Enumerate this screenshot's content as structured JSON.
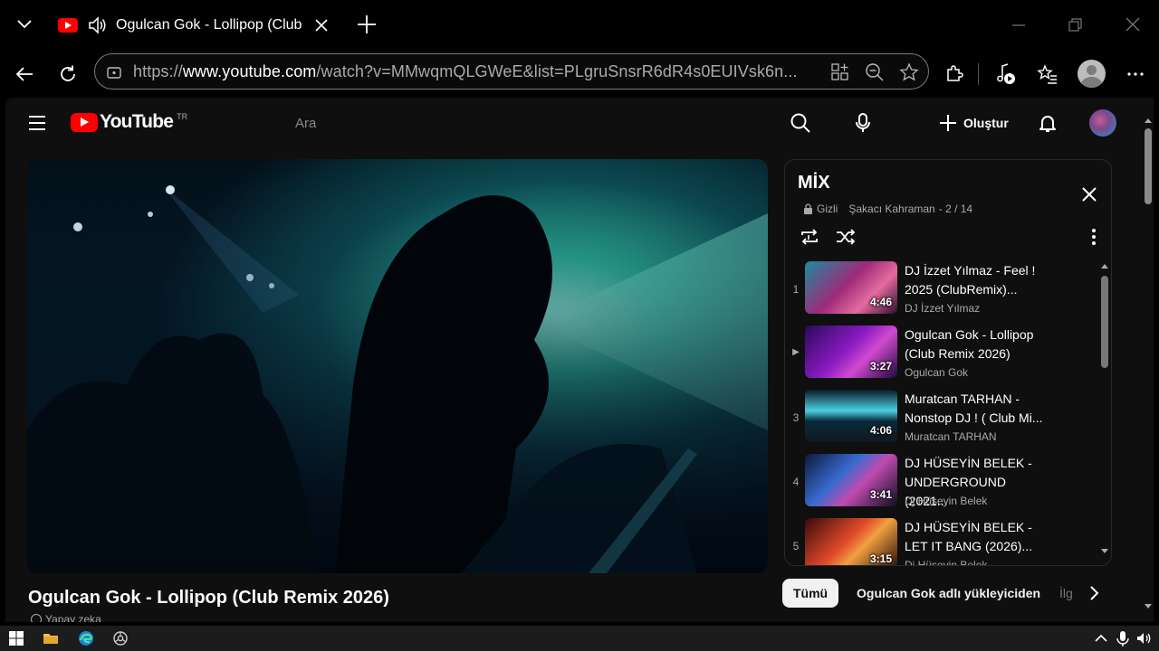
{
  "browser": {
    "tab_title": "Ogulcan Gok - Lollipop (Club",
    "url_prefix": "https://",
    "url_host": "www.youtube.com",
    "url_path": "/watch?v=MMwqmQLGWeE&list=PLgruSnsrR6dR4s0EUIVsk6n..."
  },
  "youtube": {
    "logo_text": "YouTube",
    "country_code": "TR",
    "search_placeholder": "Ara",
    "create_label": "Oluştur"
  },
  "video": {
    "title": "Ogulcan Gok - Lollipop (Club Remix 2026)",
    "ai_note": "Yapay zeka"
  },
  "playlist": {
    "title": "MİX",
    "privacy": "Gizli",
    "owner": "Şakacı Kahraman",
    "position": "- 2 / 14",
    "items": [
      {
        "index": "1",
        "title": "DJ İzzet Yılmaz - Feel ! 2025 (ClubRemix)...",
        "channel": "DJ İzzet Yılmaz",
        "duration": "4:46"
      },
      {
        "index": "▶",
        "title": "Ogulcan Gok - Lollipop (Club Remix 2026)",
        "channel": "Ogulcan Gok",
        "duration": "3:27"
      },
      {
        "index": "3",
        "title": "Muratcan TARHAN - Nonstop DJ ! ( Club Mi...",
        "channel": "Muratcan TARHAN",
        "duration": "4:06"
      },
      {
        "index": "4",
        "title": "DJ HÜSEYİN BELEK - UNDERGROUND (2021...",
        "channel": "Dj Hüseyin Belek",
        "duration": "3:41"
      },
      {
        "index": "5",
        "title": "DJ HÜSEYİN BELEK - LET IT BANG (2026)...",
        "channel": "Dj Hüseyin Belek",
        "duration": "3:15"
      }
    ]
  },
  "chips": {
    "all": "Tümü",
    "from_uploader": "Ogulcan Gok adlı yükleyiciden",
    "related": "İlg"
  },
  "colors": {
    "brand_red": "#ff0000",
    "page_bg": "#0f0f0f",
    "secondary_text": "#aaaaaa"
  }
}
